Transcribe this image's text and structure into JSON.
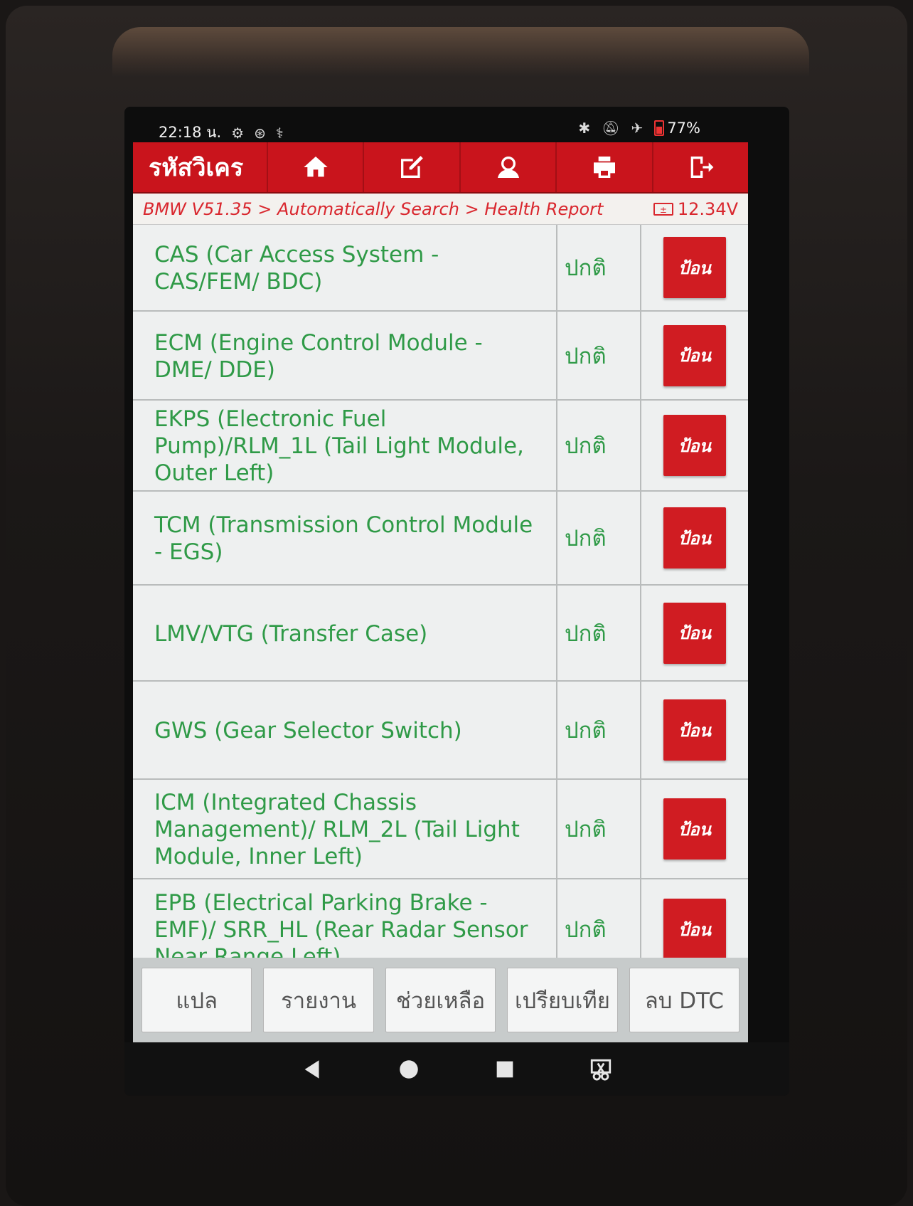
{
  "status_bar": {
    "time": "22:18 น.",
    "battery": "77%"
  },
  "app": {
    "brand": "รหัสวิเคร",
    "toolbar": [
      {
        "icon": "home-icon"
      },
      {
        "icon": "edit-icon"
      },
      {
        "icon": "user-support-icon"
      },
      {
        "icon": "print-icon"
      },
      {
        "icon": "exit-icon"
      }
    ],
    "breadcrumb": "BMW V51.35 > Automatically Search > Health Report",
    "voltage": "12.34V"
  },
  "modules": [
    {
      "name": "CAS (Car Access System - CAS/FEM/ BDC)",
      "status": "ปกติ",
      "action": "ป้อน"
    },
    {
      "name": "ECM (Engine Control Module - DME/ DDE)",
      "status": "ปกติ",
      "action": "ป้อน"
    },
    {
      "name": "EKPS (Electronic Fuel Pump)/RLM_1L (Tail Light Module, Outer Left)",
      "status": "ปกติ",
      "action": "ป้อน"
    },
    {
      "name": "TCM (Transmission Control Module - EGS)",
      "status": "ปกติ",
      "action": "ป้อน"
    },
    {
      "name": "LMV/VTG (Transfer Case)",
      "status": "ปกติ",
      "action": "ป้อน"
    },
    {
      "name": "GWS (Gear Selector Switch)",
      "status": "ปกติ",
      "action": "ป้อน"
    },
    {
      "name": "ICM (Integrated Chassis Management)/ RLM_2L (Tail Light Module, Inner Left)",
      "status": "ปกติ",
      "action": "ป้อน"
    },
    {
      "name": "EPB (Electrical Parking Brake - EMF)/ SRR_HL (Rear Radar Sensor Near Range Left)",
      "status": "ปกติ",
      "action": "ป้อน"
    }
  ],
  "bottom_buttons": [
    {
      "label": "แปล"
    },
    {
      "label": "รายงาน"
    },
    {
      "label": "ช่วยเหลือ"
    },
    {
      "label": "เปรียบเทีย"
    },
    {
      "label": "ลบ DTC"
    }
  ]
}
